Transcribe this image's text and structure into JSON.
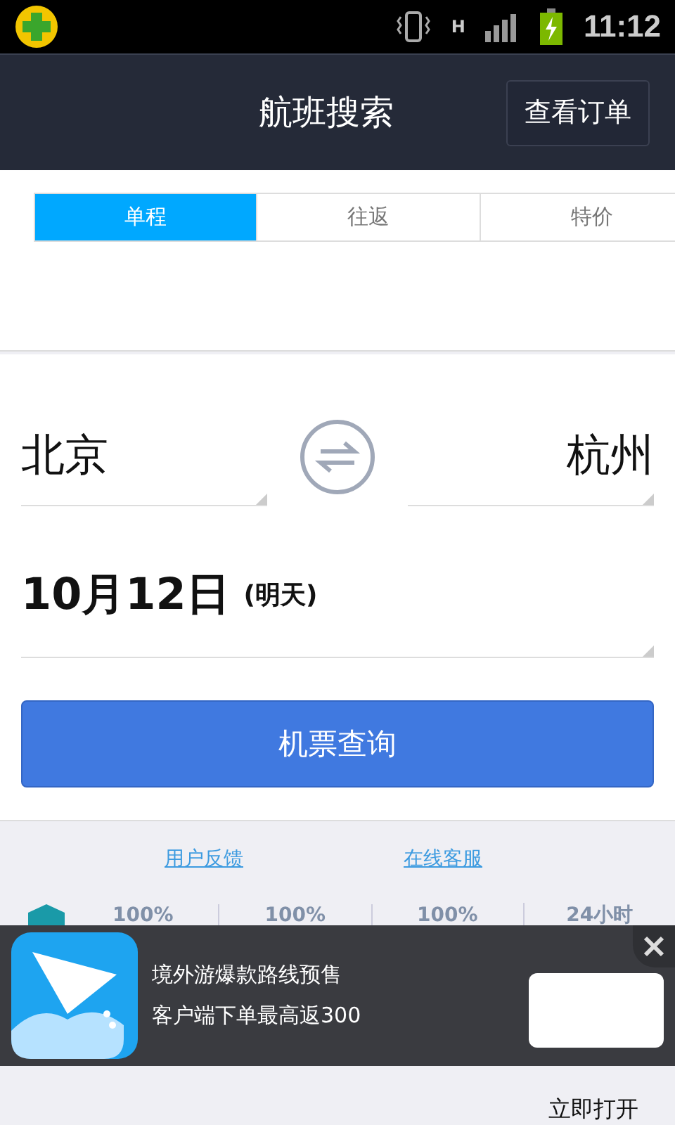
{
  "status_bar": {
    "time": "11:12",
    "network": "H"
  },
  "header": {
    "title": "航班搜索",
    "action": "查看订单"
  },
  "tabs": [
    {
      "label": "单程",
      "selected": true
    },
    {
      "label": "往返",
      "selected": false
    },
    {
      "label": "特价",
      "selected": false
    }
  ],
  "route": {
    "from": "北京",
    "to": "杭州"
  },
  "date": {
    "day": "10月12日",
    "hint": "(明天)"
  },
  "search_button": "机票查询",
  "links": [
    "用户反馈",
    "在线客服"
  ],
  "stats": [
    "100%",
    "100%",
    "100%",
    "24小时"
  ],
  "banner": {
    "title": "境外游爆款路线预售",
    "subtitle": "客户端下单最高返300",
    "open": "立即打开"
  }
}
